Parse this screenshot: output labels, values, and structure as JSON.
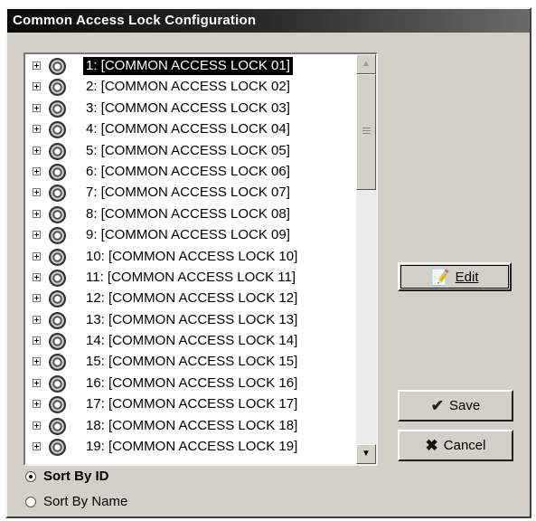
{
  "window": {
    "title": "Common Access Lock Configuration"
  },
  "tree": {
    "items": [
      {
        "label": "1: [COMMON ACCESS LOCK 01]",
        "selected": true
      },
      {
        "label": "2: [COMMON ACCESS LOCK 02]"
      },
      {
        "label": "3: [COMMON ACCESS LOCK 03]"
      },
      {
        "label": "4: [COMMON ACCESS LOCK 04]"
      },
      {
        "label": "5: [COMMON ACCESS LOCK 05]"
      },
      {
        "label": "6: [COMMON ACCESS LOCK 06]"
      },
      {
        "label": "7: [COMMON ACCESS LOCK 07]"
      },
      {
        "label": "8: [COMMON ACCESS LOCK 08]"
      },
      {
        "label": "9: [COMMON ACCESS LOCK 09]"
      },
      {
        "label": "10: [COMMON ACCESS LOCK 10]"
      },
      {
        "label": "11: [COMMON ACCESS LOCK 11]"
      },
      {
        "label": "12: [COMMON ACCESS LOCK 12]"
      },
      {
        "label": "13: [COMMON ACCESS LOCK 13]"
      },
      {
        "label": "14: [COMMON ACCESS LOCK 14]"
      },
      {
        "label": "15: [COMMON ACCESS LOCK 15]"
      },
      {
        "label": "16: [COMMON ACCESS LOCK 16]"
      },
      {
        "label": "17: [COMMON ACCESS LOCK 17]"
      },
      {
        "label": "18: [COMMON ACCESS LOCK 18]"
      },
      {
        "label": "19: [COMMON ACCESS LOCK 19]"
      }
    ],
    "item_icon": "lock-gear-icon",
    "expander_icon": "plus-expander-icon"
  },
  "buttons": {
    "edit": {
      "label": "Edit",
      "icon": "edit-document-icon"
    },
    "save": {
      "label": "Save",
      "icon": "checkmark-icon"
    },
    "cancel": {
      "label": "Cancel",
      "icon": "x-icon"
    }
  },
  "sort": {
    "by_id": {
      "label": "Sort By ID",
      "checked": true
    },
    "by_name": {
      "label": "Sort By Name",
      "checked": false
    }
  }
}
